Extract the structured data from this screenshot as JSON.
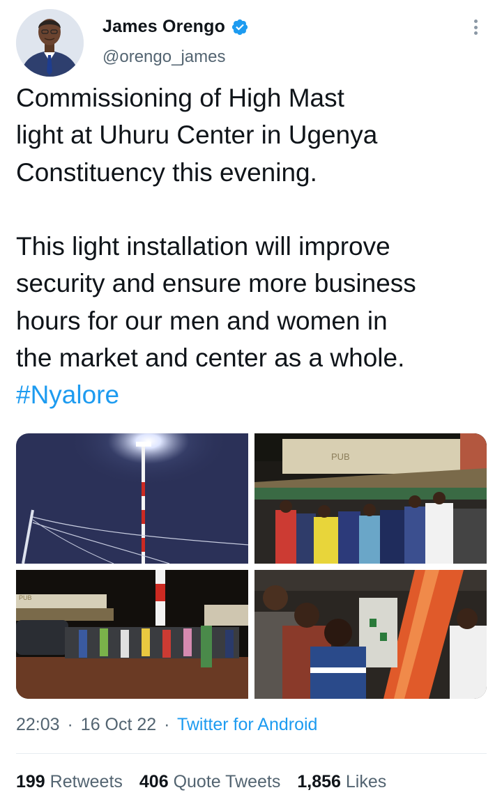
{
  "author": {
    "name": "James Orengo",
    "handle": "@orengo_james",
    "verified": true
  },
  "tweet": {
    "lines_para1": [
      "Commissioning of High Mast",
      "light at Uhuru Center in Ugenya",
      "Constituency this evening."
    ],
    "lines_para2": [
      "This light installation will improve",
      "security and ensure more business",
      "hours for our men and women in",
      "the market and center as a whole."
    ],
    "hashtag": "#Nyalore"
  },
  "media": {
    "photo1_sign_text": "",
    "photo2_sign_text": "PUB",
    "photo3_sign_text": "PUB"
  },
  "meta": {
    "time": "22:03",
    "date": "16 Oct 22",
    "separator": "·",
    "source": "Twitter for Android"
  },
  "stats": {
    "retweets_count": "199",
    "retweets_label": "Retweets",
    "quotes_count": "406",
    "quotes_label": "Quote Tweets",
    "likes_count": "1,856",
    "likes_label": "Likes"
  },
  "colors": {
    "link": "#1d9bf0",
    "secondary_text": "#536471",
    "primary_text": "#0f1419"
  },
  "icons": {
    "verified": "verified-badge-icon",
    "more": "more-options-icon"
  }
}
